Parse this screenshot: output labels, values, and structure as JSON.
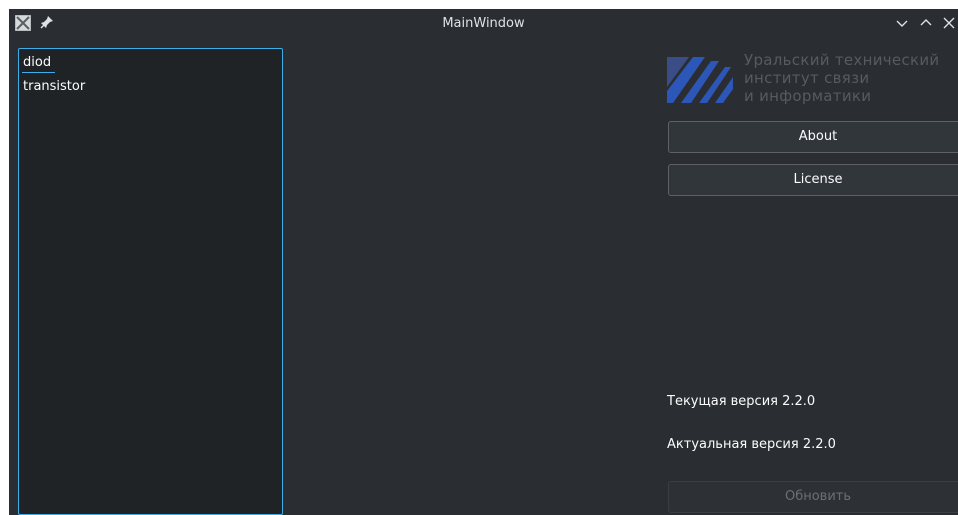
{
  "window": {
    "title": "MainWindow"
  },
  "list": {
    "items": [
      "diod",
      "transistor"
    ],
    "current_index": 0
  },
  "logo": {
    "line1": "Уральский технический",
    "line2": "институт связи",
    "line3": "и информатики"
  },
  "buttons": {
    "about": "About",
    "license": "License",
    "update": "Обновить"
  },
  "version": {
    "current": "Текущая версия 2.2.0",
    "latest": "Актуальная версия 2.2.0"
  },
  "colors": {
    "accent": "#3daee9",
    "window_bg": "#2a2e32",
    "list_bg": "#202326",
    "logo_blue": "#2c57b8"
  }
}
